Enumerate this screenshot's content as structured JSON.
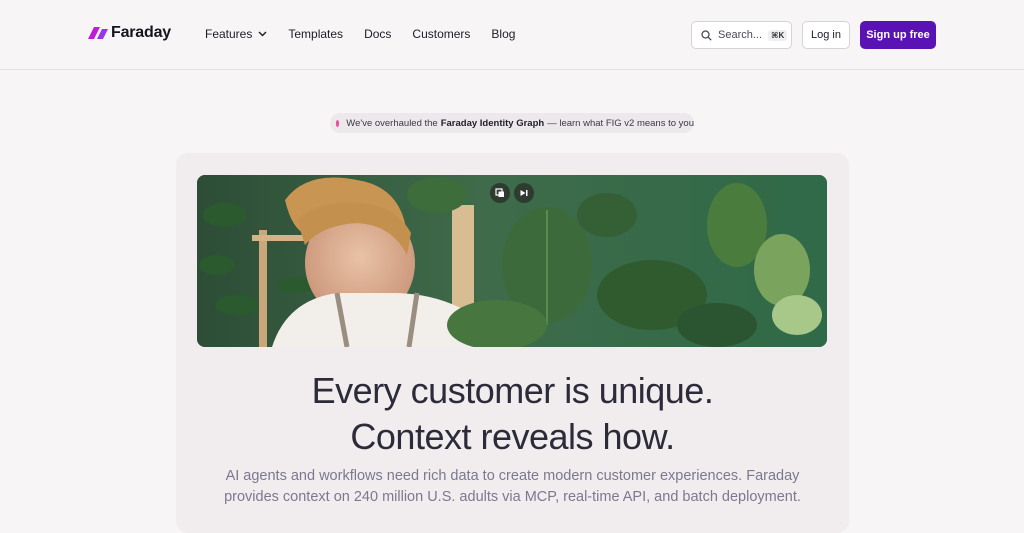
{
  "brand": {
    "name": "Faraday",
    "accent": "#5a12b4",
    "logo_color": "#c21ad6"
  },
  "nav": {
    "items": [
      {
        "label": "Features",
        "has_dropdown": true
      },
      {
        "label": "Templates"
      },
      {
        "label": "Docs"
      },
      {
        "label": "Customers"
      },
      {
        "label": "Blog"
      }
    ]
  },
  "search": {
    "label": "Search...",
    "shortcut": "⌘K"
  },
  "auth": {
    "login": "Log in",
    "signup": "Sign up free"
  },
  "announcement": {
    "prefix": "We've overhauled the",
    "highlight": "Faraday Identity Graph",
    "suffix": "— learn what FIG v2 means to you",
    "dot_color": "#ec4d9a"
  },
  "hero": {
    "media_controls": [
      "picture-in-picture-icon",
      "skip-forward-icon"
    ],
    "headline_line1": "Every customer is unique.",
    "headline_line2": "Context reveals how.",
    "subtext_line1": "AI agents and workflows need rich data to create modern customer experiences. Faraday",
    "subtext_line2": "provides context on 240 million U.S. adults via MCP, real-time API, and batch deployment."
  }
}
